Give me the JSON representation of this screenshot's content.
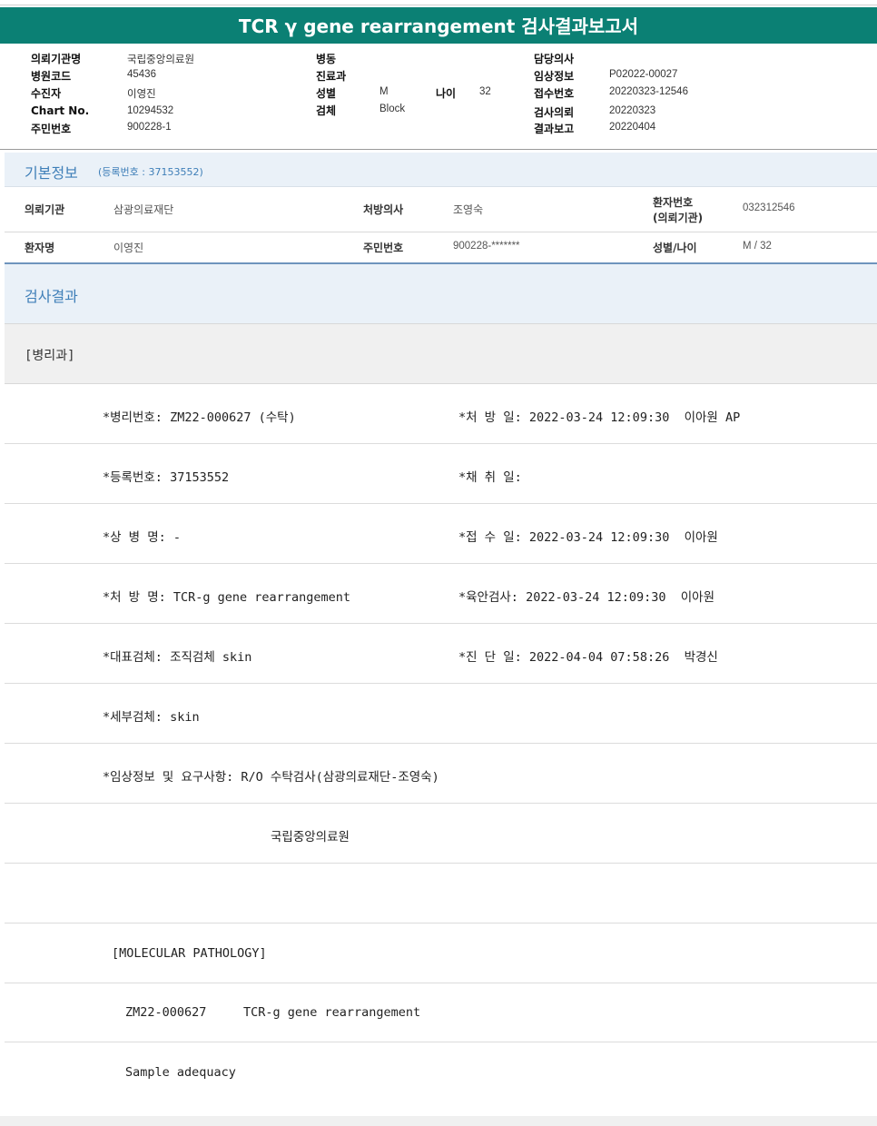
{
  "title": "TCR γ gene rearrangement 검사결과보고서",
  "header": {
    "col1": [
      {
        "label": "의뢰기관명",
        "value": "국립중앙의료원"
      },
      {
        "label": "병원코드",
        "value": "45436"
      },
      {
        "label": "수진자",
        "value": "이영진"
      },
      {
        "label": "Chart No.",
        "value": "10294532"
      },
      {
        "label": "주민번호",
        "value": "900228-1"
      }
    ],
    "col2": [
      {
        "label": "병동",
        "value": ""
      },
      {
        "label": "진료과",
        "value": ""
      },
      {
        "label": "성별",
        "value": "M"
      },
      {
        "label": "검체",
        "value": "Block"
      }
    ],
    "age": {
      "label": "나이",
      "value": "32"
    },
    "col3": [
      {
        "label": "담당의사",
        "value": ""
      },
      {
        "label": "임상정보",
        "value": "P02022-00027"
      },
      {
        "label": "접수번호",
        "value": "20220323-12546"
      },
      {
        "label": "검사의뢰",
        "value": "20220323"
      },
      {
        "label": "결과보고",
        "value": "20220404"
      }
    ]
  },
  "basic_info": {
    "title": "기본정보",
    "subtitle": "(등록번호 : 37153552)",
    "row1": {
      "institution_label": "의뢰기관",
      "institution": "삼광의료재단",
      "doctor_label": "처방의사",
      "doctor": "조영숙",
      "patient_no_label_1": "환자번호",
      "patient_no_label_2": "(의뢰기관)",
      "patient_no": "032312546"
    },
    "row2": {
      "name_label": "환자명",
      "name": "이영진",
      "rrn_label": "주민번호",
      "rrn": "900228-*******",
      "sex_age_label": "성별/나이",
      "sex_age": "M / 32"
    }
  },
  "results": {
    "title": "검사결과",
    "department": "[병리과]",
    "lines": [
      {
        "left": "*병리번호: ZM22-000627 (수탁)",
        "right": "*처 방 일: 2022-03-24 12:09:30  이아원 AP"
      },
      {
        "left": "*등록번호: 37153552",
        "right": "*채 취 일:"
      },
      {
        "left": "*상 병 명: -",
        "right": "*접 수 일: 2022-03-24 12:09:30  이아원"
      },
      {
        "left": "*처 방 명: TCR-g gene rearrangement",
        "right": "*육안검사: 2022-03-24 12:09:30  이아원"
      },
      {
        "left": "*대표검체: 조직검체 skin",
        "right": "*진 단 일: 2022-04-04 07:58:26  박경신"
      },
      {
        "left": "*세부검체: skin",
        "right": ""
      },
      {
        "left": "*임상정보 및 요구사항: R/O 수탁검사(삼광의료재단-조영숙)",
        "right": ""
      }
    ],
    "hospital_line": "국립중앙의료원",
    "blank_line": "",
    "molecular_header": "[MOLECULAR PATHOLOGY]",
    "molecular_line": "ZM22-000627     TCR-g gene rearrangement",
    "adequacy_line": "Sample adequacy"
  }
}
